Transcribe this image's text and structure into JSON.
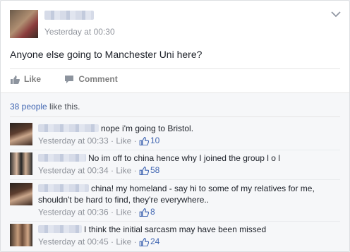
{
  "post": {
    "timestamp": "Yesterday at 00:30",
    "text": "Anyone else going to Manchester Uni here?",
    "actions": {
      "like_label": "Like",
      "comment_label": "Comment"
    }
  },
  "likes_summary": {
    "count_link": "38 people",
    "suffix": " like this."
  },
  "comments": [
    {
      "text": "nope i'm going to Bristol.",
      "time": "Yesterday at 00:33",
      "sep": " · ",
      "like_label": "Like",
      "like_sep": " · ",
      "likes": "10"
    },
    {
      "text": "No im off to china hence why I joined the group l o l",
      "time": "Yesterday at 00:34",
      "sep": " · ",
      "like_label": "Like",
      "like_sep": " · ",
      "likes": "58"
    },
    {
      "text": "china! my homeland - say hi to some of my relatives for me, shouldn't be hard to find, they're everywhere..",
      "time": "Yesterday at 00:36",
      "sep": " · ",
      "like_label": "Like",
      "like_sep": " · ",
      "likes": "8"
    },
    {
      "text": "I think the initial sarcasm may have been missed",
      "time": "Yesterday at 00:45",
      "sep": " · ",
      "like_label": "Like",
      "like_sep": " · ",
      "likes": "24"
    }
  ],
  "colors": {
    "link": "#4267b2",
    "meta": "#90949c",
    "background": "#f6f7f9"
  }
}
